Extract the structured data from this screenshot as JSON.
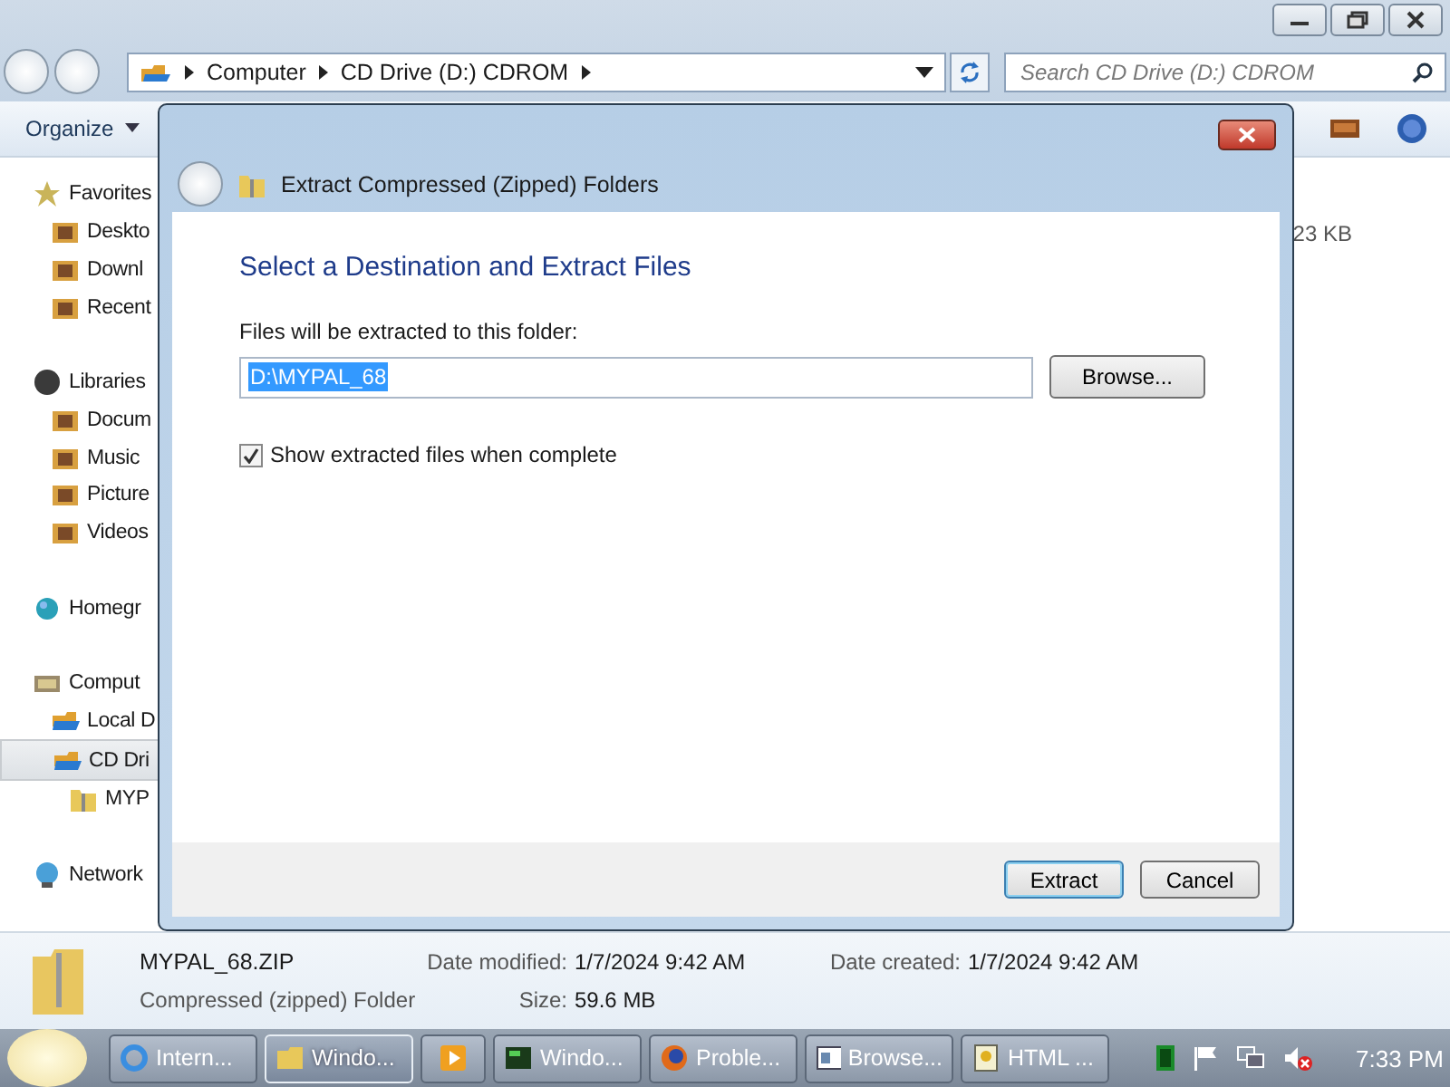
{
  "explorer": {
    "address_path": [
      "Computer",
      "CD Drive (D:) CDROM"
    ],
    "search": {
      "placeholder": "Search CD Drive (D:) CDROM"
    },
    "toolbar": {
      "organize": "Organize"
    },
    "sidebar": {
      "items": [
        {
          "label": "Favorites",
          "selected": false,
          "children": [
            {
              "label": "Deskto",
              "selected": false
            },
            {
              "label": "Downl",
              "selected": false
            },
            {
              "label": "Recent",
              "selected": false
            }
          ]
        },
        {
          "label": "Libraries",
          "selected": false,
          "children": [
            {
              "label": "Docum",
              "selected": false
            },
            {
              "label": "Music",
              "selected": false
            },
            {
              "label": "Picture",
              "selected": false
            },
            {
              "label": "Videos",
              "selected": false
            }
          ]
        },
        {
          "label": "Homegr",
          "selected": false
        },
        {
          "label": "Comput",
          "selected": false,
          "children": [
            {
              "label": "Local D",
              "selected": false
            },
            {
              "label": "CD Dri",
              "selected": true,
              "children": [
                {
                  "label": "MYP",
                  "selected": false
                }
              ]
            }
          ]
        },
        {
          "label": "Network",
          "selected": false
        }
      ]
    },
    "content": {
      "size_fragment": "23 KB"
    },
    "details": {
      "name": "MYPAL_68.ZIP",
      "type": "Compressed (zipped) Folder",
      "fields": [
        {
          "label": "Date modified:",
          "value": "1/7/2024 9:42 AM"
        },
        {
          "label": "Size:",
          "value": "59.6 MB"
        },
        {
          "label": "Date created:",
          "value": "1/7/2024 9:42 AM"
        }
      ]
    }
  },
  "dialog": {
    "title": "Extract Compressed (Zipped) Folders",
    "heading": "Select a Destination and Extract Files",
    "field_label": "Files will be extracted to this folder:",
    "path": {
      "value": "D:\\MYPAL_68",
      "text_selected": true
    },
    "browse": "Browse...",
    "show_files": {
      "label": "Show extracted files when complete",
      "checked": true
    },
    "buttons": [
      {
        "label": "Extract",
        "default": true
      },
      {
        "label": "Cancel",
        "default": false
      }
    ]
  },
  "taskbar": {
    "buttons": [
      {
        "kind": "app",
        "label": "Intern...",
        "selected": false
      },
      {
        "kind": "app",
        "label": "Windo...",
        "selected": true
      },
      {
        "kind": "icon",
        "selected": false
      },
      {
        "kind": "app",
        "label": "Windo...",
        "selected": false
      },
      {
        "kind": "app",
        "label": "Proble...",
        "selected": false
      },
      {
        "kind": "app",
        "label": "Browse...",
        "selected": false
      },
      {
        "kind": "app",
        "label": "HTML ...",
        "selected": false
      }
    ],
    "clock": "7:33 PM"
  }
}
